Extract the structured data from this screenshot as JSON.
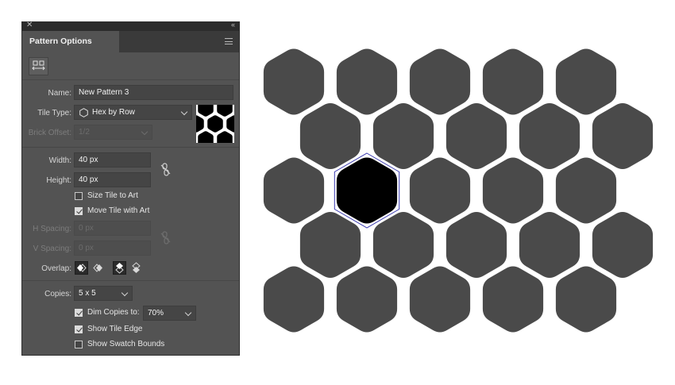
{
  "panel": {
    "title": "Pattern Options",
    "close_glyph": "✕",
    "collapse_glyph": "‹‹",
    "name_label": "Name:",
    "name_value": "New Pattern 3",
    "tile_type_label": "Tile Type:",
    "tile_type_value": "Hex by Row",
    "brick_offset_label": "Brick Offset:",
    "brick_offset_value": "1/2",
    "width_label": "Width:",
    "width_value": "40 px",
    "height_label": "Height:",
    "height_value": "40 px",
    "size_tile_label": "Size Tile to Art",
    "size_tile_checked": false,
    "move_tile_label": "Move Tile with Art",
    "move_tile_checked": true,
    "h_spacing_label": "H Spacing:",
    "h_spacing_value": "0 px",
    "v_spacing_label": "V Spacing:",
    "v_spacing_value": "0 px",
    "overlap_label": "Overlap:",
    "copies_label": "Copies:",
    "copies_value": "5 x 5",
    "dim_copies_label": "Dim Copies to:",
    "dim_copies_checked": true,
    "dim_copies_value": "70%",
    "show_tile_edge_label": "Show Tile Edge",
    "show_tile_edge_checked": true,
    "show_swatch_bounds_label": "Show Swatch Bounds",
    "show_swatch_bounds_checked": false
  },
  "icons": [
    "close-icon",
    "collapse-icon",
    "panel-menu-icon",
    "tile-editing-tool-icon",
    "hexagon-icon",
    "chevron-down-icon",
    "link-proportions-icon",
    "overlap-left-in-front-icon",
    "overlap-right-in-front-icon",
    "overlap-top-in-front-icon",
    "overlap-bottom-in-front-icon"
  ],
  "colors": {
    "panel_bg": "#535353",
    "copy_hex": "#4a4a4a",
    "tile_hex": "#000000",
    "tile_edge": "#3a3ab0"
  },
  "pattern": {
    "rows": 5,
    "columns": 5,
    "copies_opacity": 0.7
  }
}
